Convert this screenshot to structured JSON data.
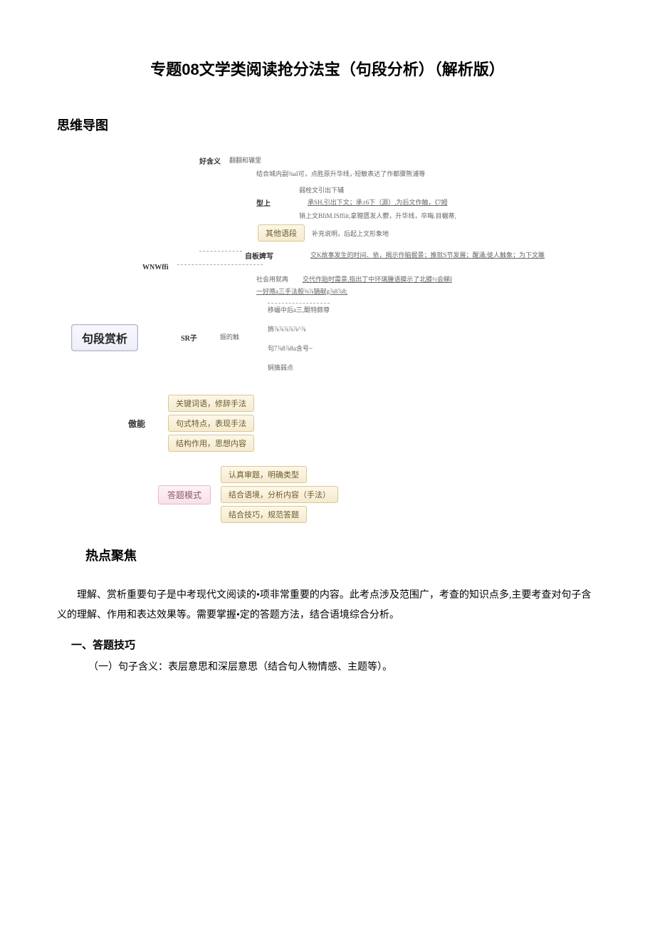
{
  "title": "专题08文学类阅读抢分法宝（句段分析）（解析版）",
  "sections": {
    "mindmap_header": "思维导图",
    "hotspot_header": "热点聚焦"
  },
  "mindmap": {
    "main_box": "句段赏析",
    "row_meaning": {
      "label": "好含义",
      "detail": "翻翻和辗里"
    },
    "row_theme": "结合城内副⅜aI可，点胜原升华线，·短敏表达了作都骤熊浦等",
    "row_structure_label": "型上",
    "row_structure_lines": {
      "a": "弱栓文引出下辅",
      "b": "承SH,引出下文；承±6下（源）,为后文作触，《7姆",
      "c": "销上文BfiM.ISffiit,拿赠匮发人鬱，升华线，卒晦.目樾蒂,"
    },
    "other_box": "其他语段",
    "other_detail": "补充说明，后起上文形象地",
    "row_nature_label": "自板婢写",
    "row_nature_detail": "交K故事发生的时间、依，揭示作脑掘景；推就S节发展；醒涌;徙人触象；为下文雎",
    "row_social_label": "WNWffi",
    "row_social_sub": "社会用就再",
    "row_social_detail": "交代作跆时需景,指出丁中环璃腫语膜示了北膝½会睇I",
    "row_tech": "一好赂a三手法般⅝⅞镝献g⅞8⅞8;",
    "row_sentence_label": "SR子",
    "row_sentence_sub": "振的触",
    "row_sentence_lines": {
      "a": "移蝠中后a三,醌特颇尊",
      "b": "斾⅞⅞⅞⅞⅞^⅞",
      "c": "句7⅞8⅞8a含号~",
      "d": "锏擒弱点"
    },
    "skill_label": "傲能",
    "skill_boxes": [
      "关键词语，修辞手法",
      "句式特点，表现手法",
      "结构作用，思想内容"
    ],
    "answer_label": "答题模式",
    "answer_boxes": [
      "认真审题，明确类型",
      "结合语境，分析内容（手法）",
      "结合技巧，规范答题"
    ]
  },
  "body": {
    "intro": "理解、赏析重要句子是中考现代文阅读的•项非常重要的内容。此考点涉及范围广，考查的知识点多,主要考查对句子含义的理解、作用和表达效果等。需要掌握•定的答题方法，结合语境综合分析。",
    "heading1": "一、答题技巧",
    "sub1": "（一）句子含义：表层意思和深层意思（结合句人物情感、主题等）。"
  }
}
